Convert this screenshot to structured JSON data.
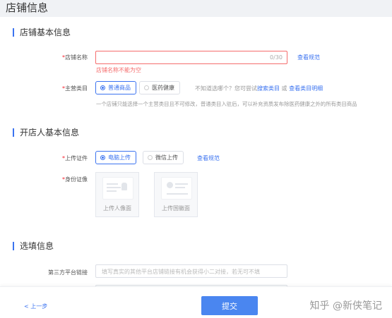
{
  "page": {
    "title": "店铺信息"
  },
  "sections": {
    "basic": {
      "title": "店铺基本信息"
    },
    "owner": {
      "title": "开店人基本信息"
    },
    "optional": {
      "title": "选填信息"
    }
  },
  "shop_name": {
    "label": "店铺名称",
    "required_mark": "*",
    "placeholder": "",
    "counter": "0/30",
    "error": "店铺名称不能为空",
    "link": "查看规范"
  },
  "category": {
    "label": "主营类目",
    "required_mark": "*",
    "options": [
      {
        "label": "普通商品",
        "selected": true
      },
      {
        "label": "医药健康",
        "selected": false
      }
    ],
    "hint_prefix": "不知道选哪个？您可尝试",
    "hint_link1": "搜索类目",
    "hint_mid": " 或 ",
    "hint_link2": "查看类目明细",
    "note": "一个店铺只能选择一个主营类目且不可修改，普通类目入驻后，可以补充资质发布除医药健康之外的所有类目商品"
  },
  "upload_cert": {
    "label": "上传证件",
    "required_mark": "*",
    "options": [
      {
        "label": "电脑上传",
        "selected": true
      },
      {
        "label": "微信上传",
        "selected": false
      }
    ],
    "link": "查看规范"
  },
  "id_card": {
    "label": "身份证像",
    "required_mark": "*",
    "front": "上传人像面",
    "back": "上传国徽面"
  },
  "third_party": {
    "label": "第三方平台链接",
    "placeholder": "填写真实的其他平台店铺链接有机会获得小二对接，若无可不填"
  },
  "footer": {
    "prev_label": "< 上一步",
    "submit_label": "提交",
    "watermark": "知乎 @新侠笔记"
  },
  "colors": {
    "accent": "#3b73f0",
    "error": "#f56c6c",
    "submit": "#4a86f0"
  }
}
